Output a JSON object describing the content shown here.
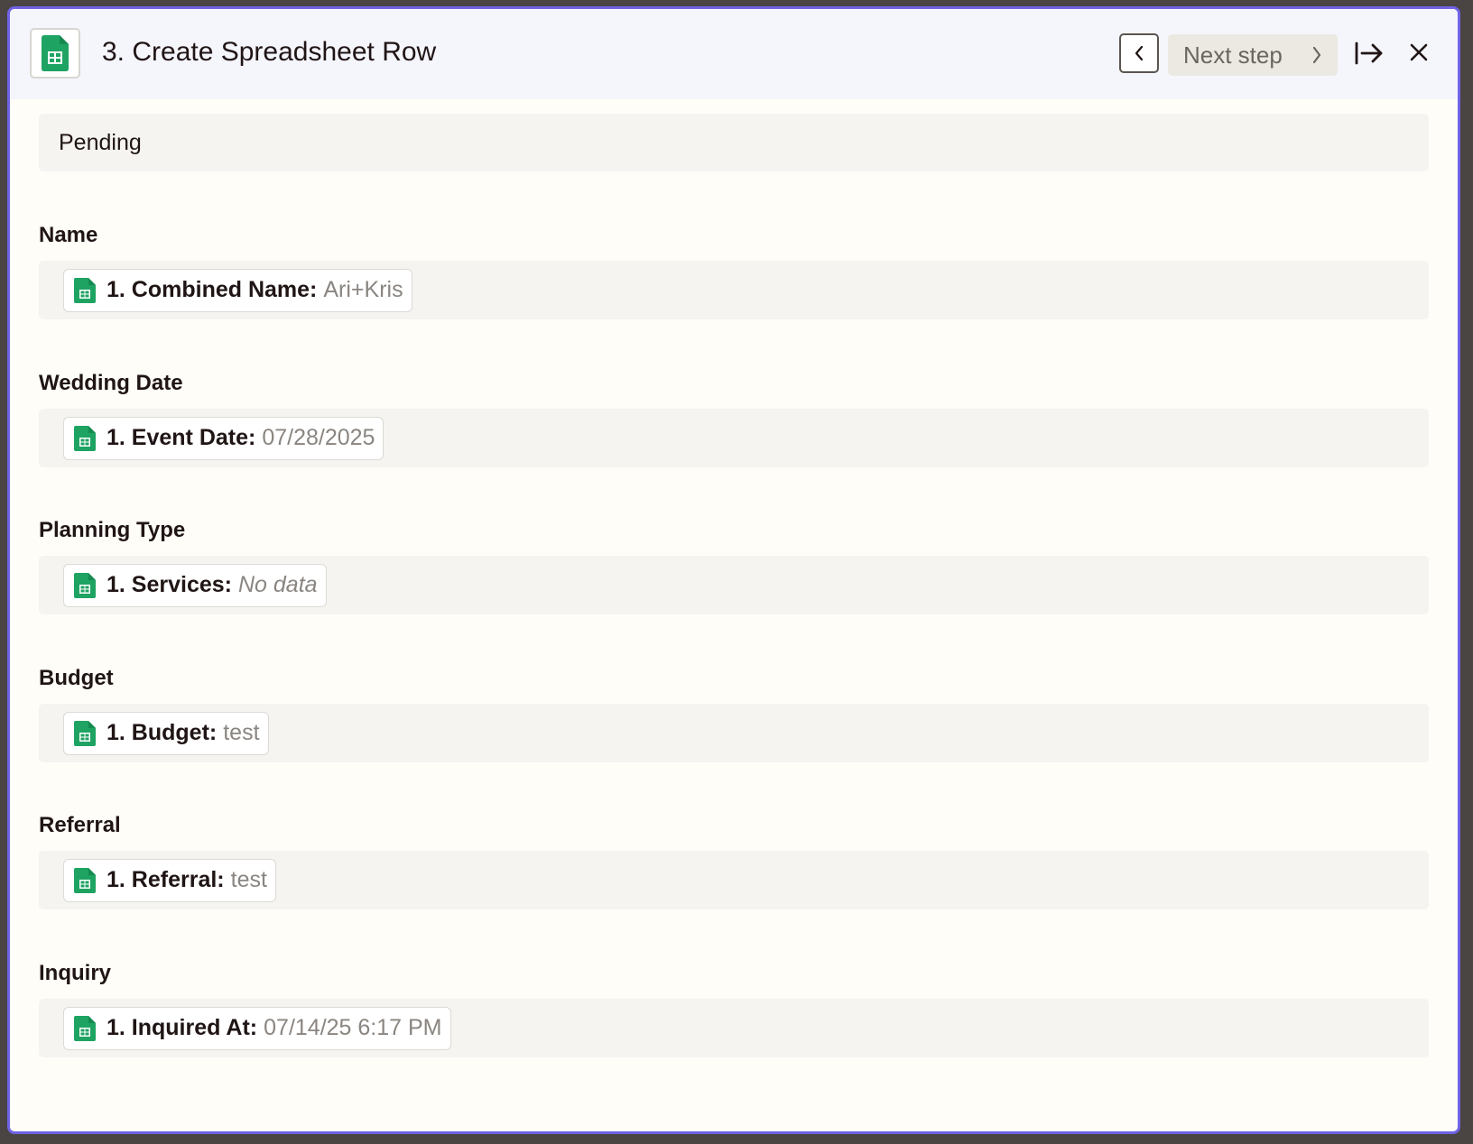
{
  "header": {
    "title": "3. Create Spreadsheet Row",
    "app_icon": "google-sheets-icon",
    "prev_icon": "chevron-left-icon",
    "next_label": "Next step",
    "next_icon": "chevron-right-icon",
    "collapse_icon": "arrow-right-to-bar-icon",
    "close_icon": "close-icon"
  },
  "status": "Pending",
  "fields": [
    {
      "label": "Name",
      "key": "1. Combined Name:",
      "value": "Ari+Kris",
      "italic": false
    },
    {
      "label": "Wedding Date",
      "key": "1. Event Date:",
      "value": "07/28/2025",
      "italic": false
    },
    {
      "label": "Planning Type",
      "key": "1. Services:",
      "value": "No data",
      "italic": true
    },
    {
      "label": "Budget",
      "key": "1. Budget:",
      "value": "test",
      "italic": false
    },
    {
      "label": "Referral",
      "key": "1. Referral:",
      "value": "test",
      "italic": false
    },
    {
      "label": "Inquiry",
      "key": "1. Inquired At:",
      "value": "07/14/25 6:17 PM",
      "italic": false
    }
  ],
  "colors": {
    "accent_border": "#6f63e6",
    "sheets_green": "#1ea362",
    "text_primary": "#201515",
    "text_muted": "#8a8580"
  }
}
